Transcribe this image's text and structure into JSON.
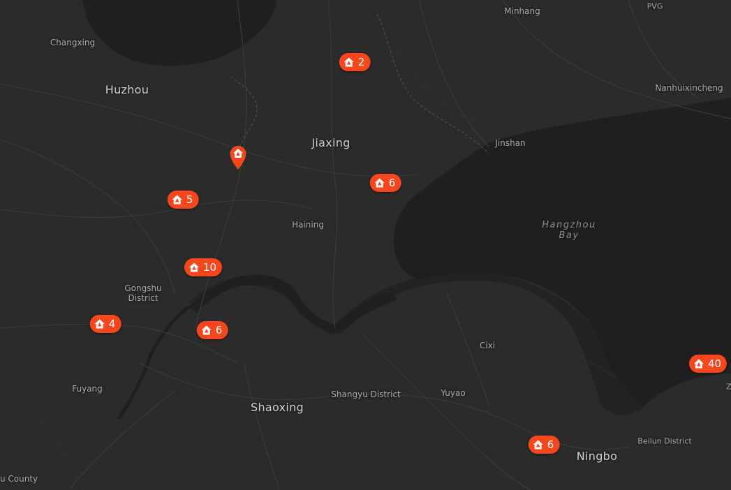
{
  "map": {
    "place_labels": [
      {
        "id": "minhang",
        "text": "Minhang",
        "kind": "town"
      },
      {
        "id": "pvg",
        "text": "PVG",
        "kind": "town"
      },
      {
        "id": "changxing",
        "text": "Changxing",
        "kind": "town"
      },
      {
        "id": "huzhou",
        "text": "Huzhou",
        "kind": "city"
      },
      {
        "id": "nanhuixincheng",
        "text": "Nanhuixincheng",
        "kind": "town"
      },
      {
        "id": "jiaxing",
        "text": "Jiaxing",
        "kind": "city"
      },
      {
        "id": "jinshan",
        "text": "Jinshan",
        "kind": "town"
      },
      {
        "id": "hangzhou-bay",
        "text": "Hangzhou\nBay",
        "kind": "water"
      },
      {
        "id": "haining",
        "text": "Haining",
        "kind": "town"
      },
      {
        "id": "gongshu",
        "text": "Gongshu\nDistrict",
        "kind": "town"
      },
      {
        "id": "cixi",
        "text": "Cixi",
        "kind": "town"
      },
      {
        "id": "fuyang",
        "text": "Fuyang",
        "kind": "town"
      },
      {
        "id": "shaoxing",
        "text": "Shaoxing",
        "kind": "city"
      },
      {
        "id": "shangyu",
        "text": "Shangyu District",
        "kind": "town"
      },
      {
        "id": "yuyao",
        "text": "Yuyao",
        "kind": "town"
      },
      {
        "id": "beilun",
        "text": "Beilun District",
        "kind": "town"
      },
      {
        "id": "ningbo",
        "text": "Ningbo",
        "kind": "city"
      },
      {
        "id": "county",
        "text": "u County",
        "kind": "town"
      },
      {
        "id": "edge-z",
        "text": "Z",
        "kind": "town"
      }
    ],
    "clusters": [
      {
        "id": "cluster-jiaxing-north",
        "count": "2"
      },
      {
        "id": "cluster-jiaxing-south",
        "count": "6"
      },
      {
        "id": "cluster-huzhou-south",
        "count": "5"
      },
      {
        "id": "cluster-hangzhou-north",
        "count": "10"
      },
      {
        "id": "cluster-hangzhou-west",
        "count": "4"
      },
      {
        "id": "cluster-hangzhou-center",
        "count": "6"
      },
      {
        "id": "cluster-ningbo",
        "count": "6"
      },
      {
        "id": "cluster-east-edge",
        "count": "40"
      }
    ],
    "single_marker": {
      "id": "single-pin",
      "icon": "house-pin-icon"
    },
    "colors": {
      "marker": "#f5461e",
      "land": "#2b2b2b",
      "water": "#1f1f1f",
      "roads": "#3a3a3a"
    }
  }
}
